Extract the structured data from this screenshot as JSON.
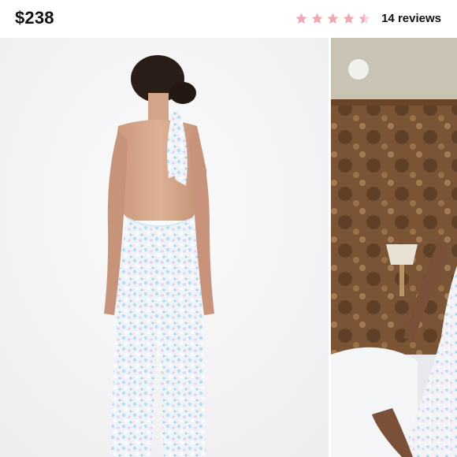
{
  "listing": {
    "price": "$238",
    "rating": {
      "value": 4.5,
      "max": 5,
      "label": "14 reviews"
    },
    "colors": {
      "star_filled": "#f4a7b3",
      "star_empty": "#f2d6db",
      "text": "#111111"
    }
  },
  "gallery": {
    "images": [
      {
        "name": "photo-back-view",
        "description_icon": "sequin-halter-jumpsuit-back"
      },
      {
        "name": "photo-room-view",
        "description_icon": "sequin-jumpsuit-on-bed"
      }
    ]
  }
}
